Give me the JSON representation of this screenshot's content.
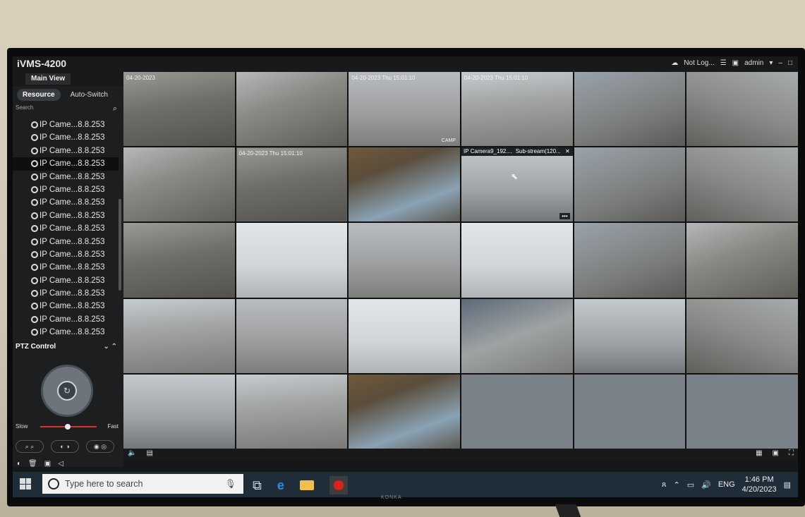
{
  "app": {
    "title": "iVMS-4200",
    "login_status": "Not Log...",
    "user": "admin",
    "main_view_tab": "Main View"
  },
  "sidebar": {
    "tabs": [
      "Resource",
      "Auto-Switch"
    ],
    "search_placeholder": "Search",
    "cameras": [
      "IP Came...8.8.253",
      "IP Came...8.8.253",
      "IP Came...8.8.253",
      "IP Came...8.8.253",
      "IP Came...8.8.253",
      "IP Came...8.8.253",
      "IP Came...8.8.253",
      "IP Came...8.8.253",
      "IP Came...8.8.253",
      "IP Came...8.8.253",
      "IP Came...8.8.253",
      "IP Came...8.8.253",
      "IP Came...8.8.253",
      "IP Came...8.8.253",
      "IP Came...8.8.253",
      "IP Came...8.8.253",
      "IP Came...8.8.253"
    ]
  },
  "ptz": {
    "title": "PTZ Control",
    "slow_label": "Slow",
    "fast_label": "Fast"
  },
  "grid": {
    "tiles": {
      "0": {
        "ts": "04-20-2023"
      },
      "2": {
        "ts": "04-20-2023 Thu 15:01:10",
        "label": "CAMP"
      },
      "3": {
        "ts": "04-20-2023 Thu 15:01:10"
      },
      "7": {
        "ts": "04-20-2023 Thu 15:01:10"
      }
    },
    "popup": {
      "name": "IP Camera9_192....",
      "stream": "Sub-stream(120..."
    }
  },
  "taskbar": {
    "search_placeholder": "Type here to search",
    "lang": "ENG",
    "time": "1:46 PM",
    "date": "4/20/2023"
  },
  "monitor": {
    "brand": "KONKA"
  }
}
